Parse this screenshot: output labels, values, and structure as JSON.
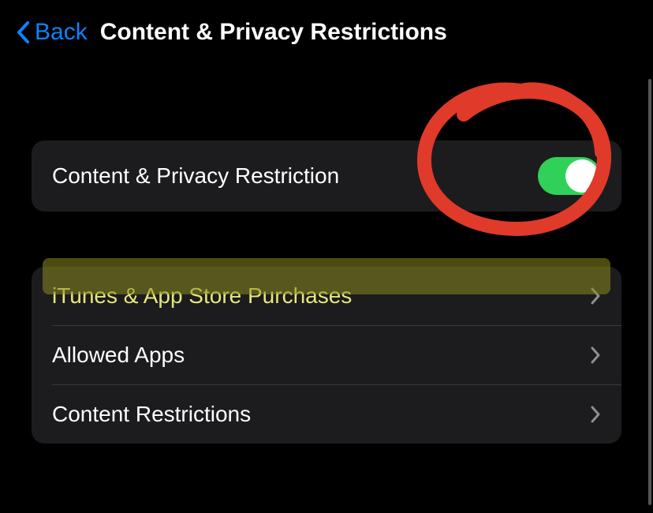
{
  "header": {
    "back_label": "Back",
    "title": "Content & Privacy Restrictions"
  },
  "toggle_section": {
    "label": "Content & Privacy Restriction",
    "enabled": true
  },
  "menu_section": {
    "items": [
      {
        "label": "iTunes & App Store Purchases",
        "highlighted": true
      },
      {
        "label": "Allowed Apps",
        "highlighted": false
      },
      {
        "label": "Content Restrictions",
        "highlighted": false
      }
    ]
  },
  "colors": {
    "accent": "#0a84ff",
    "toggle_on": "#30d158",
    "annotation_red": "#e03a2a",
    "annotation_yellow": "#8a8a1f"
  }
}
